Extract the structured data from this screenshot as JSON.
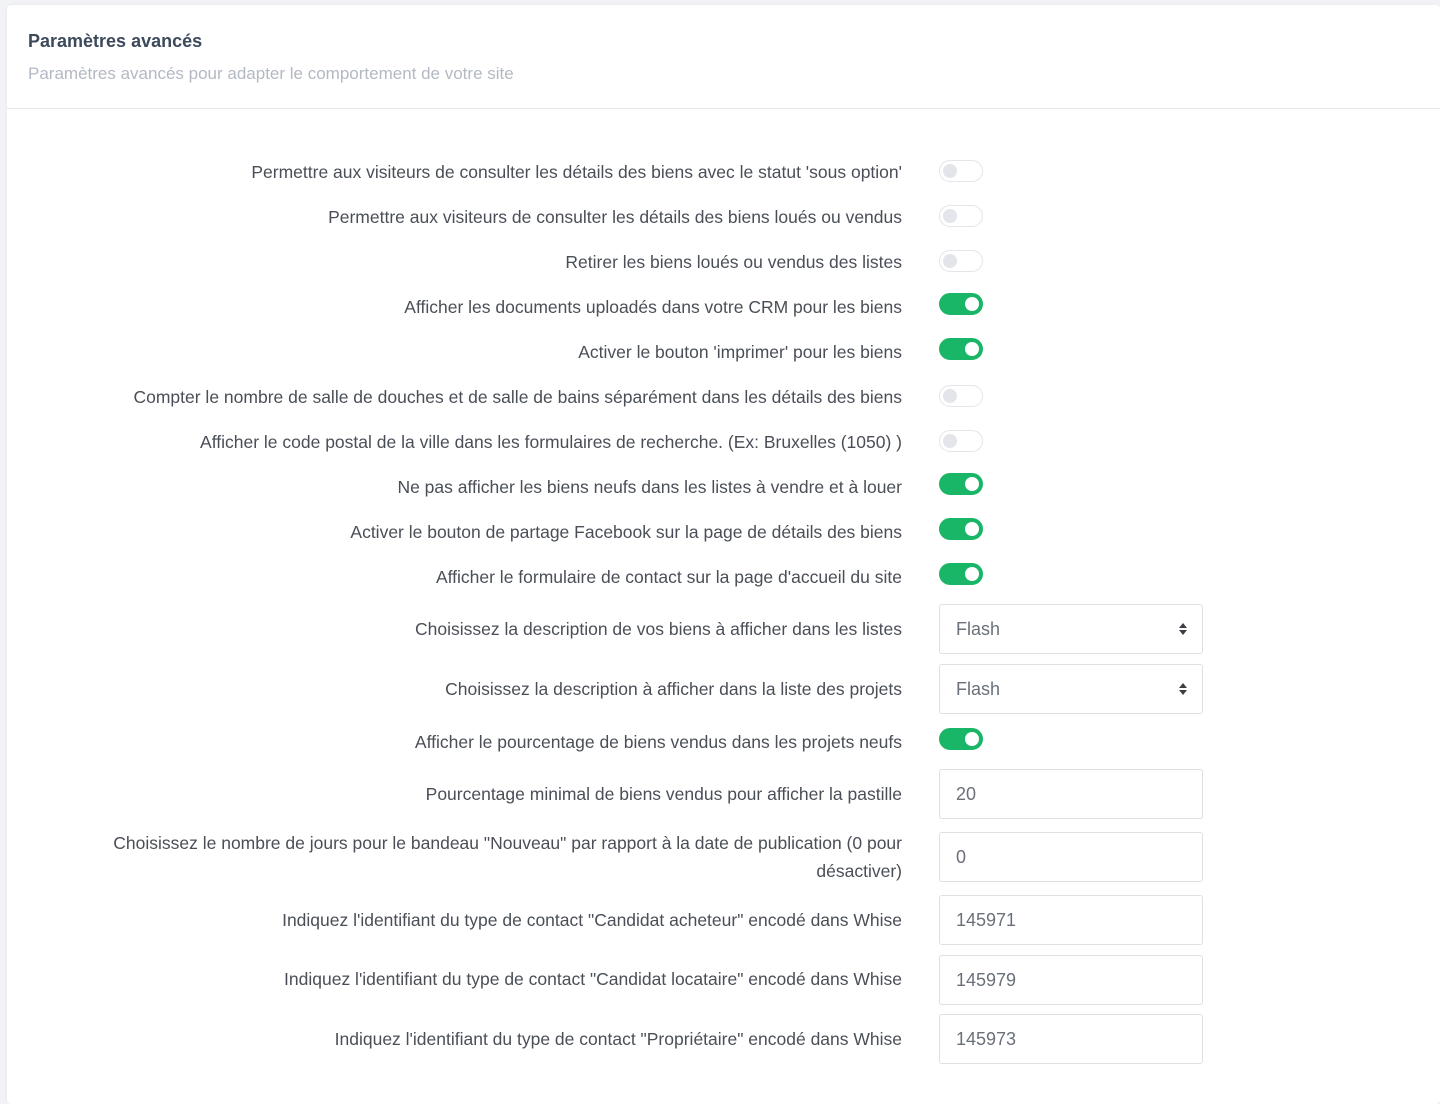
{
  "header": {
    "title": "Paramètres avancés",
    "subtitle": "Paramètres avancés pour adapter le comportement de votre site"
  },
  "settings": [
    {
      "label": "Permettre aux visiteurs de consulter les détails des biens avec le statut 'sous option'",
      "control": "toggle",
      "checked": false
    },
    {
      "label": "Permettre aux visiteurs de consulter les détails des biens loués ou vendus",
      "control": "toggle",
      "checked": false
    },
    {
      "label": "Retirer les biens loués ou vendus des listes",
      "control": "toggle",
      "checked": false
    },
    {
      "label": "Afficher les documents uploadés dans votre CRM pour les biens",
      "control": "toggle",
      "checked": true
    },
    {
      "label": "Activer le bouton 'imprimer' pour les biens",
      "control": "toggle",
      "checked": true
    },
    {
      "label": "Compter le nombre de salle de douches et de salle de bains séparément dans les détails des biens",
      "control": "toggle",
      "checked": false
    },
    {
      "label": "Afficher le code postal de la ville dans les formulaires de recherche. (Ex: Bruxelles (1050) )",
      "control": "toggle",
      "checked": false
    },
    {
      "label": "Ne pas afficher les biens neufs dans les listes à vendre et à louer",
      "control": "toggle",
      "checked": true
    },
    {
      "label": "Activer le bouton de partage Facebook sur la page de détails des biens",
      "control": "toggle",
      "checked": true
    },
    {
      "label": "Afficher le formulaire de contact sur la page d'accueil du site",
      "control": "toggle",
      "checked": true
    },
    {
      "label": "Choisissez la description de vos biens à afficher dans les listes",
      "control": "select",
      "value": "Flash"
    },
    {
      "label": "Choisissez la description à afficher dans la liste des projets",
      "control": "select",
      "value": "Flash"
    },
    {
      "label": "Afficher le pourcentage de biens vendus dans les projets neufs",
      "control": "toggle",
      "checked": true
    },
    {
      "label": "Pourcentage minimal de biens vendus pour afficher la pastille",
      "control": "input",
      "value": "20"
    },
    {
      "label_line1": "Choisissez le nombre de jours pour le bandeau \"Nouveau\" par rapport à la date de publication (0 pour",
      "label_line2": "désactiver)",
      "control": "input",
      "value": "0"
    },
    {
      "label": "Indiquez l'identifiant du type de contact \"Candidat acheteur\" encodé dans Whise",
      "control": "input",
      "value": "145971"
    },
    {
      "label": "Indiquez l'identifiant du type de contact \"Candidat locataire\" encodé dans Whise",
      "control": "input",
      "value": "145979"
    },
    {
      "label": "Indiquez l'identifiant du type de contact \"Propriétaire\" encodé dans Whise",
      "control": "input",
      "value": "145973"
    }
  ],
  "colors": {
    "toggle_on": "#1ab667",
    "toggle_off_border": "#e3e5ea",
    "title": "#3c4a5c",
    "subtitle": "#b3b9c3",
    "label": "#4a4f57"
  }
}
